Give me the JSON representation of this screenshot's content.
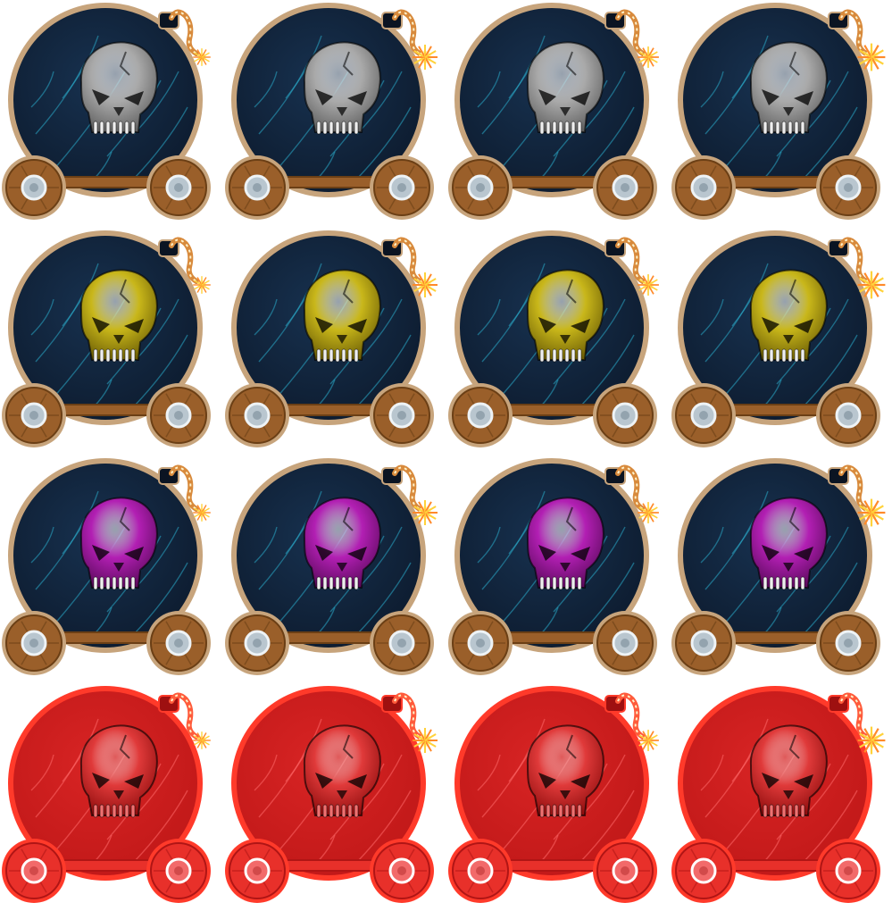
{
  "sprite_sheet": {
    "background": "#ffffff",
    "rows": [
      {
        "variant": "grey",
        "skull_color": "#a9a9a9",
        "skull_shade": "#5e5e5e",
        "body_color": "#0d1b2e",
        "rim_color": "#c7a47c",
        "wheel_color": "#9a5f2a",
        "hub_color": "#b9c6cf",
        "frames": [
          "frame-1",
          "frame-2",
          "frame-3",
          "frame-4"
        ],
        "spark_scale": [
          0.7,
          1.0,
          0.85,
          1.1
        ]
      },
      {
        "variant": "yellow",
        "skull_color": "#c9b71a",
        "skull_shade": "#6a5c05",
        "body_color": "#0d1b2e",
        "rim_color": "#c7a47c",
        "wheel_color": "#9a5f2a",
        "hub_color": "#b9c6cf",
        "frames": [
          "frame-1",
          "frame-2",
          "frame-3",
          "frame-4"
        ],
        "spark_scale": [
          0.7,
          1.0,
          0.85,
          1.1
        ]
      },
      {
        "variant": "magenta",
        "skull_color": "#b21fb3",
        "skull_shade": "#5a0a5b",
        "body_color": "#0d1b2e",
        "rim_color": "#c7a47c",
        "wheel_color": "#9a5f2a",
        "hub_color": "#b9c6cf",
        "frames": [
          "frame-1",
          "frame-2",
          "frame-3",
          "frame-4"
        ],
        "spark_scale": [
          0.7,
          1.0,
          0.85,
          1.1
        ]
      },
      {
        "variant": "red-flash",
        "skull_color": "#e03a3a",
        "skull_shade": "#8e0d0d",
        "body_color": "#c01818",
        "rim_color": "#ff3a2a",
        "wheel_color": "#e8302a",
        "hub_color": "#f26a6a",
        "frames": [
          "frame-1",
          "frame-2",
          "frame-3",
          "frame-4"
        ],
        "spark_scale": [
          0.7,
          1.0,
          0.85,
          1.1
        ]
      }
    ]
  }
}
